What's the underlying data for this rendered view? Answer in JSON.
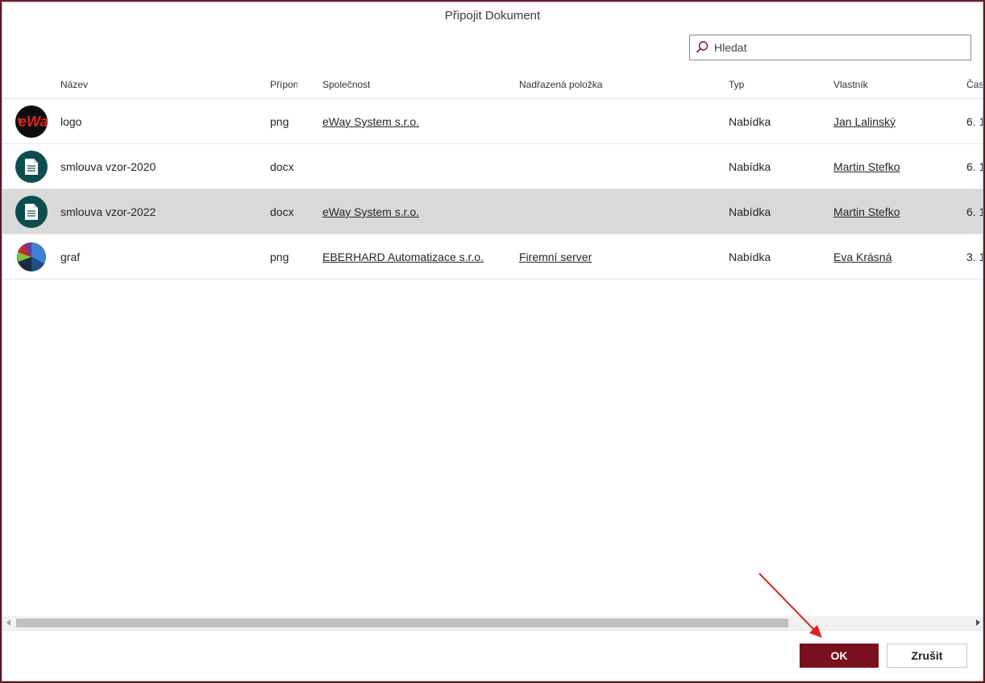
{
  "dialog": {
    "title": "Připojit Dokument"
  },
  "search": {
    "placeholder": "Hledat",
    "value": ""
  },
  "columns": {
    "name": "Název",
    "ext": "Přípon",
    "company": "Společnost",
    "parent": "Nadřazená položka",
    "type": "Typ",
    "owner": "Vlastník",
    "time": "Čas"
  },
  "rows": [
    {
      "icon": "logo-thumbnail",
      "name": "logo",
      "ext": "png",
      "company": "eWay System s.r.o.",
      "parent": "",
      "type": "Nabídka",
      "owner": "Jan Lalinský",
      "time": "6. 1"
    },
    {
      "icon": "document-icon",
      "name": "smlouva vzor-2020",
      "ext": "docx",
      "company": "",
      "parent": "",
      "type": "Nabídka",
      "owner": "Martin Stefko",
      "time": "6. 1"
    },
    {
      "icon": "document-icon",
      "name": "smlouva vzor-2022",
      "ext": "docx",
      "company": "eWay System s.r.o.",
      "parent": "",
      "type": "Nabídka",
      "owner": "Martin Stefko",
      "time": "6. 1",
      "selected": true
    },
    {
      "icon": "pie-chart-thumbnail",
      "name": "graf",
      "ext": "png",
      "company": "EBERHARD Automatizace s.r.o.",
      "parent": "Firemní server",
      "type": "Nabídka",
      "owner": "Eva Krásná",
      "time": "3. 1"
    }
  ],
  "buttons": {
    "ok": "OK",
    "cancel": "Zrušit"
  },
  "colors": {
    "primary": "#7a0f1e",
    "selected_row": "#d9d9d9",
    "doc_icon_bg": "#0e4d4d",
    "annotation_arrow": "#e02020"
  }
}
